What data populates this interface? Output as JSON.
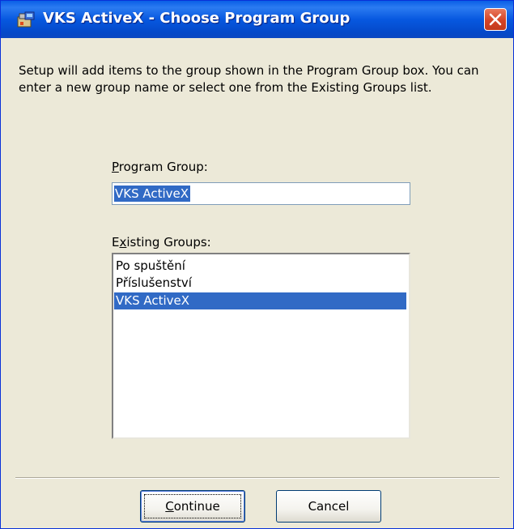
{
  "window": {
    "title": "VKS ActiveX - Choose Program Group"
  },
  "intro_text": "Setup will add items to the group shown in the Program Group box. You can enter a new group name or select one from the Existing Groups list.",
  "program_group": {
    "label_first": "P",
    "label_rest": "rogram Group:",
    "value": "VKS ActiveX"
  },
  "existing_groups": {
    "label_first": "E",
    "label_mnemonic": "x",
    "label_rest": "isting Groups:",
    "items": [
      "Po spuštění",
      "Příslušenství",
      "VKS ActiveX"
    ],
    "selected": "VKS ActiveX"
  },
  "buttons": {
    "continue_mnemonic": "C",
    "continue_rest": "ontinue",
    "cancel": "Cancel"
  },
  "colors": {
    "title_bar": "#0a5fe6",
    "selection": "#316ac5",
    "dialog_bg": "#ece9d8"
  }
}
